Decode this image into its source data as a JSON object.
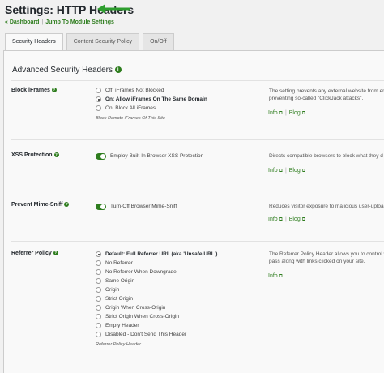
{
  "header": {
    "title": "Settings: HTTP Headers",
    "breadcrumbs": [
      "« Dashboard",
      "Jump To Module Settings"
    ],
    "separator": "|"
  },
  "tabs": [
    {
      "label": "Security Headers",
      "active": true
    },
    {
      "label": "Content Security Policy",
      "active": false
    },
    {
      "label": "On/Off",
      "active": false
    }
  ],
  "section": {
    "title": "Advanced Security Headers"
  },
  "links": {
    "info": "Info",
    "blog": "Blog",
    "sep": "|",
    "ext_icon": "external-link-icon"
  },
  "rows": {
    "block_iframes": {
      "label": "Block iFrames",
      "options": [
        "Off: iFrames Not Blocked",
        "On: Allow iFrames On The Same Domain",
        "On: Block All iFrames"
      ],
      "selected": 1,
      "hint": "Block Remote iFrames Of This Site",
      "desc1": "The setting prevents any external website from em",
      "desc2": "preventing so-called \"ClickJack attacks\"."
    },
    "xss": {
      "label": "XSS Protection",
      "toggle_label": "Employ Built-In Browser XSS Protection",
      "desc1": "Directs compatible browsers to block what they d"
    },
    "mime": {
      "label": "Prevent Mime-Sniff",
      "toggle_label": "Turn-Off Browser Mime-Sniff",
      "desc1": "Reduces visitor exposure to malicious user-upload"
    },
    "referrer": {
      "label": "Referrer Policy",
      "options": [
        "Default: Full Referrer URL (aka 'Unsafe URL')",
        "No Referrer",
        "No Referrer When Downgrade",
        "Same Origin",
        "Origin",
        "Strict Origin",
        "Origin When Cross-Origin",
        "Strict Origin When Cross-Origin",
        "Empty Header",
        "Disabled - Don't Send This Header"
      ],
      "selected": 0,
      "hint": "Referrer Policy Header",
      "desc1": "The Referrer Policy Header allows you to control w",
      "desc2": "pass along with links clicked on your site."
    }
  },
  "colors": {
    "accent": "#2e7d1e",
    "arrow": "#2e9e2e"
  }
}
